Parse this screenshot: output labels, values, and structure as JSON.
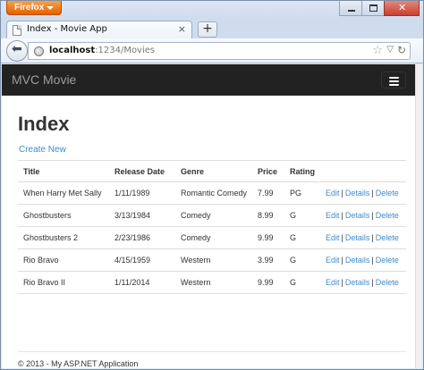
{
  "browser": {
    "app_button": "Firefox",
    "tab_title": "Index - Movie App",
    "tab_close": "×",
    "new_tab": "+",
    "url_host": "localhost",
    "url_path": ":1234/Movies",
    "window_close": "✕"
  },
  "site": {
    "brand": "MVC Movie",
    "page_title": "Index",
    "create_link": "Create New",
    "footer": "© 2013 - My ASP.NET Application"
  },
  "table": {
    "headers": [
      "Title",
      "Release Date",
      "Genre",
      "Price",
      "Rating"
    ],
    "rows": [
      {
        "title": "When Harry Met Sally",
        "date": "1/11/1989",
        "genre": "Romantic Comedy",
        "price": "7.99",
        "rating": "PG"
      },
      {
        "title": "Ghostbusters",
        "date": "3/13/1984",
        "genre": "Comedy",
        "price": "8.99",
        "rating": "G"
      },
      {
        "title": "Ghostbusters 2",
        "date": "2/23/1986",
        "genre": "Comedy",
        "price": "9.99",
        "rating": "G"
      },
      {
        "title": "Rio Bravo",
        "date": "4/15/1959",
        "genre": "Western",
        "price": "3.99",
        "rating": "G"
      },
      {
        "title": "Rio Bravo II",
        "date": "1/11/2014",
        "genre": "Western",
        "price": "9.99",
        "rating": "G"
      }
    ],
    "actions": {
      "edit": "Edit",
      "details": "Details",
      "delete": "Delete",
      "separator": "|"
    }
  },
  "colors": {
    "link": "#428bca",
    "navbar": "#222222",
    "brand_text": "#9d9d9d",
    "firefox_orange": "#e66000"
  },
  "icons": [
    "firefox-menu-caret-icon",
    "minimize-icon",
    "maximize-icon",
    "close-icon",
    "page-favicon-icon",
    "back-arrow-icon",
    "globe-icon",
    "bookmark-star-icon",
    "dropmarker-icon",
    "reload-icon",
    "hamburger-menu-icon"
  ]
}
